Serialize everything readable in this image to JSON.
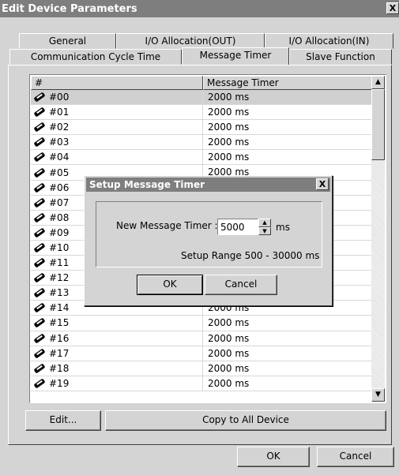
{
  "window": {
    "title": "Edit Device Parameters",
    "close_glyph": "X"
  },
  "tabs_row1": [
    "General",
    "I/O Allocation(OUT)",
    "I/O Allocation(IN)"
  ],
  "tabs_row2": [
    "Communication Cycle Time",
    "Message Timer",
    "Slave Function"
  ],
  "active_tab": "Message Timer",
  "table": {
    "columns": [
      "#",
      "Message Timer"
    ],
    "rows": [
      {
        "id": "#00",
        "value": "2000 ms"
      },
      {
        "id": "#01",
        "value": "2000 ms"
      },
      {
        "id": "#02",
        "value": "2000 ms"
      },
      {
        "id": "#03",
        "value": "2000 ms"
      },
      {
        "id": "#04",
        "value": "2000 ms"
      },
      {
        "id": "#05",
        "value": "2000 ms"
      },
      {
        "id": "#06",
        "value": ""
      },
      {
        "id": "#07",
        "value": ""
      },
      {
        "id": "#08",
        "value": ""
      },
      {
        "id": "#09",
        "value": ""
      },
      {
        "id": "#10",
        "value": ""
      },
      {
        "id": "#11",
        "value": ""
      },
      {
        "id": "#12",
        "value": ""
      },
      {
        "id": "#13",
        "value": ""
      },
      {
        "id": "#14",
        "value": "2000 ms"
      },
      {
        "id": "#15",
        "value": "2000 ms"
      },
      {
        "id": "#16",
        "value": "2000 ms"
      },
      {
        "id": "#17",
        "value": "2000 ms"
      },
      {
        "id": "#18",
        "value": "2000 ms"
      },
      {
        "id": "#19",
        "value": "2000 ms"
      }
    ]
  },
  "buttons": {
    "edit": "Edit...",
    "copy_all": "Copy to All Device",
    "ok": "OK",
    "cancel": "Cancel"
  },
  "dialog": {
    "title": "Setup Message Timer",
    "close_glyph": "X",
    "label": "New Message Timer :",
    "value": "5000",
    "unit": "ms",
    "range": "Setup Range 500 - 30000 ms",
    "ok": "OK",
    "cancel": "Cancel"
  },
  "colors": {
    "titlebar": "#7e7e7e",
    "face": "#d4d4d4",
    "selected_row": "#d0d0d0"
  }
}
